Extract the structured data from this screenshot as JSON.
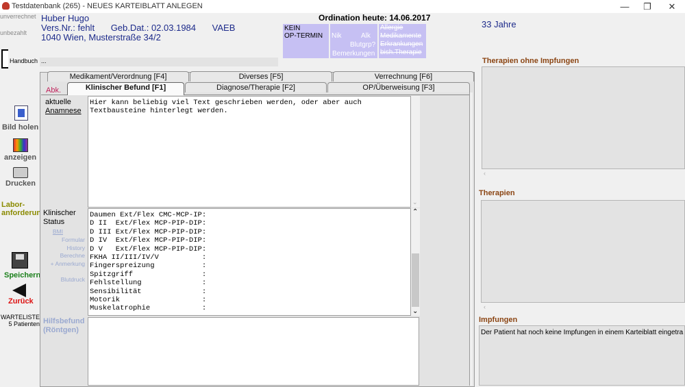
{
  "window": {
    "title": "Testdatenbank (265) -",
    "subtitle": "NEUES KARTEIBLATT ANLEGEN",
    "min": "—",
    "max": "❐",
    "close": "✕"
  },
  "sidebar": {
    "unverrechnet": "unverrechnet",
    "unbezahlt": "unbezahlt",
    "handbuch": "Handbuch",
    "bild_holen": "Bild holen",
    "anzeigen": "anzeigen",
    "drucken": "Drucken",
    "labor": "Labor-",
    "laboranf": "anforderung",
    "speichern": "Speichern",
    "zurueck": "Zurück",
    "warteliste": "WARTELISTE",
    "patienten": "5 Patienten"
  },
  "patient": {
    "name": "Huber Hugo",
    "versnr_label": "Vers.Nr.:",
    "versnr": "fehlt",
    "gebdat_label": "Geb.Dat.:",
    "gebdat": "02.03.1984",
    "kasse": "VAEB",
    "address": "1040 Wien, Musterstraße 34/2",
    "dots": "...",
    "age": "33 Jahre"
  },
  "ordination": "Ordination heute: 14.06.2017",
  "optermin": {
    "line1": "KEIN",
    "line2": "OP-TERMIN"
  },
  "flags": {
    "nik": "Nik",
    "alk": "Alk",
    "blutgrp": "Blutgrp?",
    "bemerkungen": "Bemerkungen"
  },
  "flags2": {
    "allergie": "Allergie",
    "medikamente": "Medikamente",
    "erkrankungen": "Erkrankungen",
    "bisher": "bish.Therapie"
  },
  "tabs": {
    "medikament": "Medikament/Verordnung  [F4]",
    "diverses": "Diverses  [F5]",
    "verrechnung": "Verrechnung  [F6]",
    "abk": "Abk.",
    "klinischer": "Klinischer Befund  [F1]",
    "diagnose": "Diagnose/Therapie  [F2]",
    "op": "OP/Überweisung  [F3]"
  },
  "anamnese": {
    "label1": "aktuelle",
    "label2": "Anamnese",
    "text": "Hier kann beliebig viel Text geschrieben werden, oder aber auch\nTextbausteine hinterlegt werden."
  },
  "status": {
    "label1": "Klinischer",
    "label2": "Status",
    "links": [
      "BMI",
      "Formular",
      "History",
      "Berechne",
      "+ Anmerkung",
      "Blutdruck"
    ],
    "text": "Daumen Ext/Flex CMC-MCP-IP:\nD II  Ext/Flex MCP-PIP-DIP:\nD III Ext/Flex MCP-PIP-DIP:\nD IV  Ext/Flex MCP-PIP-DIP:\nD V   Ext/Flex MCP-PIP-DIP:\nFKHA II/III/IV/V          :\nFingerspreizung           :\nSpitzgriff                :\nFehlstellung              :\nSensibilität              :\nMotorik                   :\nMuskelatrophie            :"
  },
  "hilfsbefund": {
    "label1": "Hilfsbefund",
    "label2": "(Röntgen)"
  },
  "right": {
    "therapien_ohne": "Therapien ohne Impfungen",
    "therapien": "Therapien",
    "impfungen": "Impfungen",
    "impf_text": "Der Patient hat noch keine Impfungen in einem Karteiblatt eingetra"
  }
}
